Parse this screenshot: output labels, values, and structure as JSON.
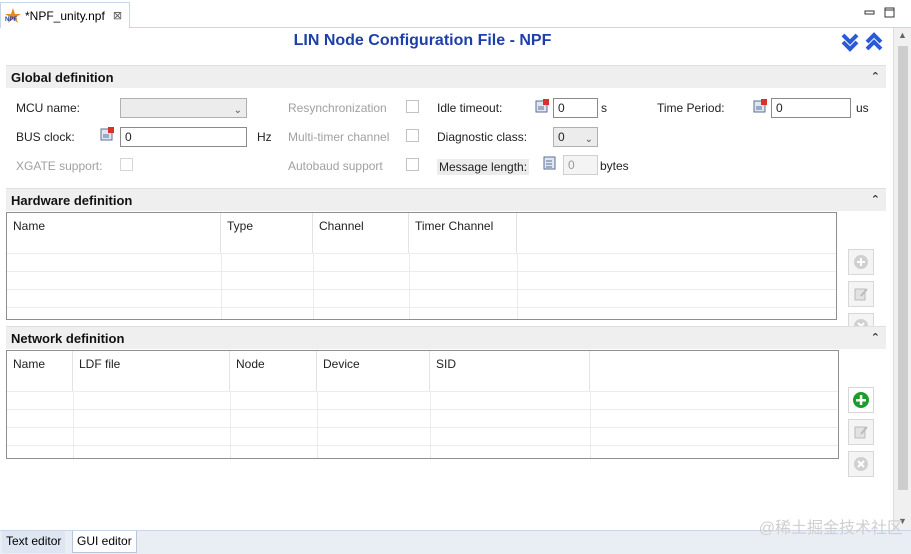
{
  "tab": {
    "label": "*NPF_unity.npf",
    "logo_text": "NPF"
  },
  "page_title": "LIN Node Configuration File - NPF",
  "global": {
    "header": "Global definition",
    "mcu_name_label": "MCU name:",
    "bus_clock_label": "BUS clock:",
    "bus_clock_value": "0",
    "bus_clock_unit": "Hz",
    "xgate_label": "XGATE support:",
    "resync_label": "Resynchronization",
    "multitimer_label": "Multi-timer channel",
    "autobaud_label": "Autobaud support",
    "idle_timeout_label": "Idle timeout:",
    "idle_timeout_value": "0",
    "idle_timeout_unit": "s",
    "diag_class_label": "Diagnostic class:",
    "diag_class_value": "0",
    "msg_length_label": "Message length:",
    "msg_length_value": "0",
    "msg_length_unit": "bytes",
    "time_period_label": "Time Period:",
    "time_period_value": "0",
    "time_period_unit": "us"
  },
  "hardware": {
    "header": "Hardware definition",
    "columns": [
      "Name",
      "Type",
      "Channel",
      "Timer Channel"
    ]
  },
  "network": {
    "header": "Network definition",
    "columns": [
      "Name",
      "LDF file",
      "Node",
      "Device",
      "SID"
    ]
  },
  "bottom_tabs": [
    "Text editor",
    "GUI editor"
  ],
  "watermark": "@稀土掘金技术社区",
  "colors": {
    "title": "#1f3fa8",
    "add_green": "#1e9c2b",
    "expand_blue": "#2a5bd7"
  }
}
